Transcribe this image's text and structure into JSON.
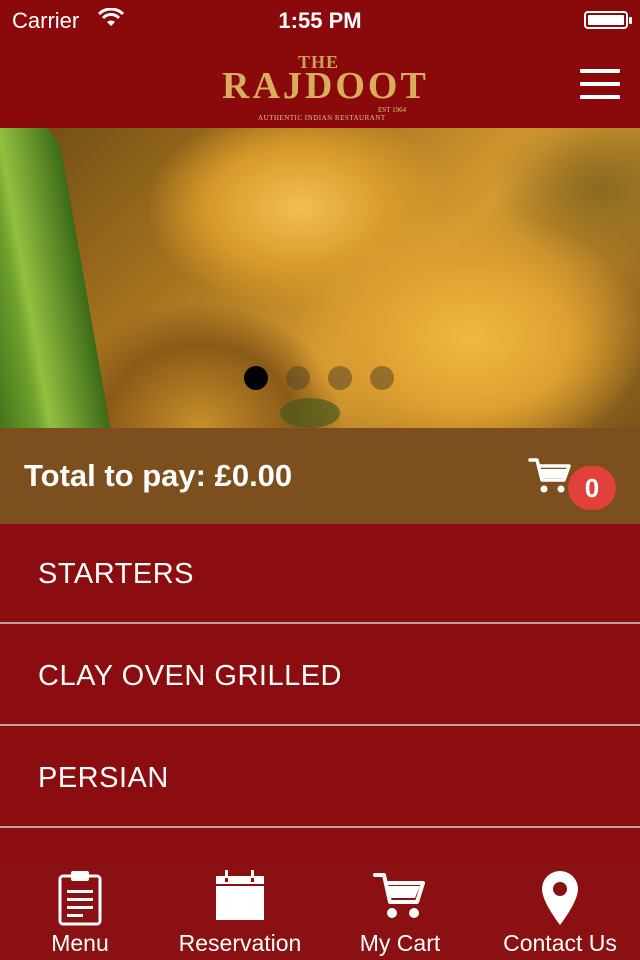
{
  "status_bar": {
    "carrier": "Carrier",
    "time": "1:55 PM"
  },
  "header": {
    "logo": {
      "the": "THE",
      "name": "RAJDOOT",
      "est": "EST 1964",
      "tagline": "AUTHENTIC INDIAN RESTAURANT"
    },
    "menu_icon": "hamburger-icon"
  },
  "carousel": {
    "slide_count": 4,
    "active_index": 0
  },
  "cart_summary": {
    "total_label": "Total to pay: £0.00",
    "cart_count": "0",
    "icon": "cart-icon"
  },
  "categories": [
    {
      "label": "STARTERS"
    },
    {
      "label": "CLAY OVEN GRILLED"
    },
    {
      "label": "PERSIAN"
    }
  ],
  "tab_bar": {
    "tabs": [
      {
        "label": "Menu",
        "icon": "clipboard-icon"
      },
      {
        "label": "Reservation",
        "icon": "calendar-icon"
      },
      {
        "label": "My Cart",
        "icon": "cart-icon"
      },
      {
        "label": "Contact Us",
        "icon": "location-pin-icon"
      }
    ]
  },
  "colors": {
    "primary": "#8c0d10",
    "total_bar": "#7d4f1f",
    "badge": "#e0413b",
    "logo_gold": "#d8ae5e"
  }
}
